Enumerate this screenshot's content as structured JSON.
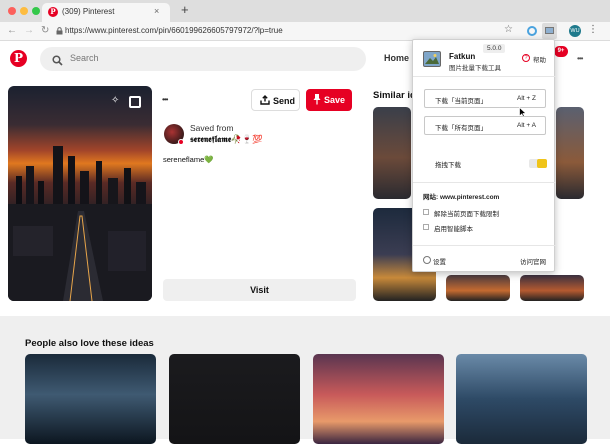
{
  "browser": {
    "tab_count": "(309)",
    "tab_title": "(309) Pinterest",
    "new_tab": "+",
    "url": "https://www.pinterest.com/pin/660199626605797972/?lp=true",
    "avatar": "WU"
  },
  "header": {
    "logo": "P",
    "search_placeholder": "Search",
    "home": "Home",
    "notif_badge": "9+",
    "more": "•••"
  },
  "pin": {
    "send": "Send",
    "save": "Save",
    "saved_from": "Saved from",
    "source": "𝖘𝖊𝖗𝖊𝖓𝖊𝖋𝖑𝖆𝖒𝖊🥀🍷💯",
    "description": "sereneflame💚",
    "visit": "Visit",
    "more": "•••"
  },
  "similar": {
    "title": "Similar id"
  },
  "lower": {
    "title": "People also love these ideas"
  },
  "extension": {
    "name": "Fatkun",
    "subtitle": "图片批量下载工具",
    "version": "5.0.0",
    "help": "帮助",
    "download_current": "下载「当前页面」",
    "shortcut_current": "Alt + Z",
    "download_all": "下载「所有页面」",
    "shortcut_all": "Alt + A",
    "drag_download": "拖拽下载",
    "site_label": "网站: www.pinterest.com",
    "option_unlimit": "解除当前页面下载限制",
    "option_smart": "启用智能脚本",
    "settings": "设置",
    "visit_site": "访问官网"
  },
  "colors": {
    "pinterest_red": "#e60023",
    "toggle_on": "#f0c419"
  }
}
